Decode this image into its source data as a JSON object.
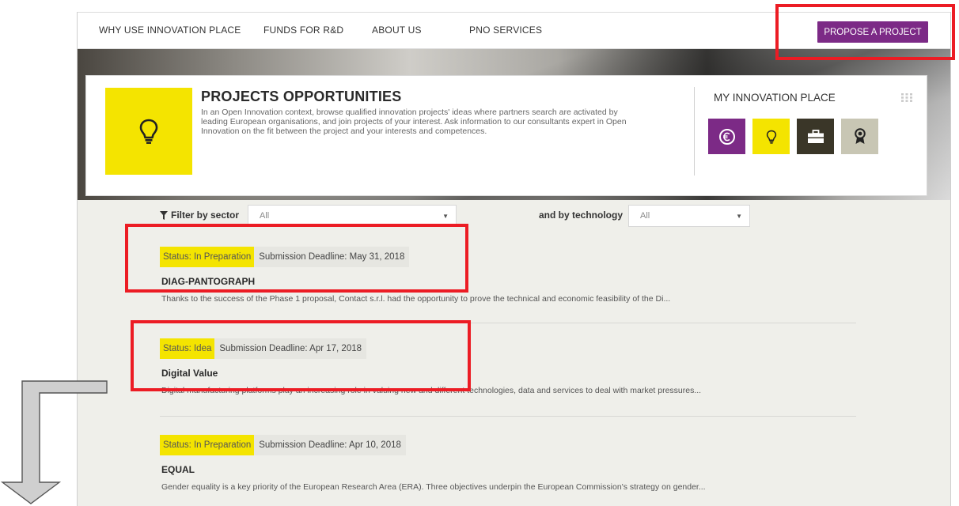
{
  "nav": {
    "items": [
      "WHY USE INNOVATION PLACE",
      "FUNDS FOR R&D",
      "ABOUT US",
      "PNO SERVICES"
    ],
    "propose_label": "PROPOSE A PROJECT"
  },
  "hero": {
    "icon": "lightbulb-icon",
    "title": "PROJECTS OPPORTUNITIES",
    "description": "In an Open Innovation context, browse qualified innovation projects' ideas where partners search are activated by leading European organisations, and join projects of your interest. Ask information to our consultants expert in Open Innovation on the fit between the project and your interests and competences.",
    "my_title": "MY INNOVATION PLACE",
    "tiles": [
      {
        "icon": "euro-icon",
        "color": "#7c2a86"
      },
      {
        "icon": "lightbulb-icon",
        "color": "#f4e400"
      },
      {
        "icon": "briefcase-icon",
        "color": "#3a3628"
      },
      {
        "icon": "award-icon",
        "color": "#c8c6b4"
      }
    ]
  },
  "filters": {
    "sector_label": "Filter by sector",
    "sector_value": "All",
    "tech_label": "and by technology",
    "tech_value": "All"
  },
  "projects": [
    {
      "status": "Status: In Preparation",
      "deadline": "Submission Deadline: May 31, 2018",
      "title": "DIAG-PANTOGRAPH",
      "summary": "Thanks to the success of the Phase 1 proposal, Contact s.r.l. had the opportunity to prove the technical and economic feasibility of the Di..."
    },
    {
      "status": "Status: Idea",
      "deadline": "Submission Deadline: Apr 17, 2018",
      "title": "Digital Value",
      "summary": "Digital manufacturing platforms play an increasing role in valuing new and different technologies, data and services to deal with market pressures..."
    },
    {
      "status": "Status: In Preparation",
      "deadline": "Submission Deadline: Apr 10, 2018",
      "title": "EQUAL",
      "summary": "Gender equality is a key priority of the European Research Area (ERA). Three objectives underpin the European Commission's strategy on gender..."
    }
  ],
  "colors": {
    "accent_purple": "#7c2a86",
    "accent_yellow": "#f4e400",
    "annotation_red": "#ec1c24"
  }
}
